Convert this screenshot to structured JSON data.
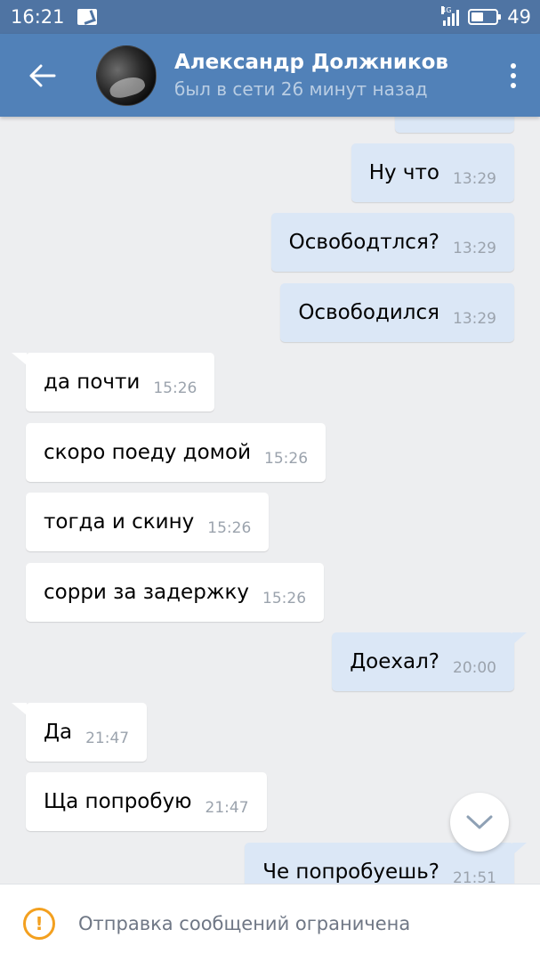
{
  "status_bar": {
    "time": "16:21",
    "network": "4G",
    "battery": "49",
    "battery_level": 0.49
  },
  "header": {
    "contact_name": "Александр Должников",
    "contact_status": "был в сети 26 минут назад"
  },
  "messages": [
    {
      "direction": "out",
      "text": "Ну что",
      "time": "13:29"
    },
    {
      "direction": "out",
      "text": "Освободтлся?",
      "time": "13:29"
    },
    {
      "direction": "out",
      "text": "Освободился",
      "time": "13:29"
    },
    {
      "direction": "in",
      "text": "да почти",
      "time": "15:26"
    },
    {
      "direction": "in",
      "text": "скоро поеду домой",
      "time": "15:26"
    },
    {
      "direction": "in",
      "text": "тогда и скину",
      "time": "15:26"
    },
    {
      "direction": "in",
      "text": "сорри за задержку",
      "time": "15:26"
    },
    {
      "direction": "out",
      "text": "Доехал?",
      "time": "20:00"
    },
    {
      "direction": "in",
      "text": "Да",
      "time": "21:47"
    },
    {
      "direction": "in",
      "text": "Ща попробую",
      "time": "21:47"
    },
    {
      "direction": "out",
      "text": "Че попробуешь?",
      "time": "21:51"
    }
  ],
  "bottom_bar": {
    "notice": "Отправка сообщений ограничена"
  },
  "colors": {
    "header_bg": "#5181b8",
    "status_bar_bg": "#4f74a3",
    "chat_bg": "#edeef0",
    "outgoing_bubble": "#dbe7f6",
    "incoming_bubble": "#ffffff",
    "warning": "#f3a01f"
  },
  "icons": {
    "back": "arrow-left-icon",
    "menu": "more-vertical-icon",
    "scroll_down": "chevron-down-icon",
    "warning": "exclamation-circle-icon"
  }
}
